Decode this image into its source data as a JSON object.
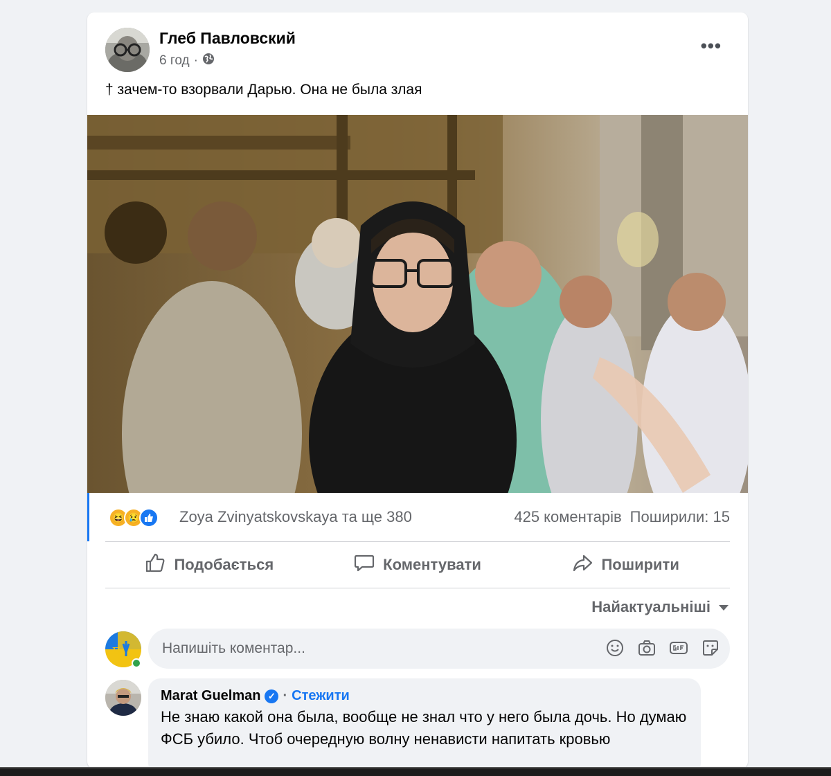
{
  "post": {
    "author": "Глеб Павловский",
    "time": "6 год",
    "separator": "·",
    "text": "† зачем-то взорвали Дарью. Она не была злая",
    "more": "•••"
  },
  "stats": {
    "reactors": "Zoya Zvinyatskovskaya та ще 380",
    "comments": "425 коментарів",
    "shares": "Поширили: 15"
  },
  "actions": {
    "like": "Подобається",
    "comment": "Коментувати",
    "share": "Поширити"
  },
  "sort": {
    "label": "Найактуальніші"
  },
  "composer": {
    "placeholder": "Напишіть коментар..."
  },
  "comment": {
    "author": "Marat Guelman",
    "follow": "Стежити",
    "text": "Не знаю какой она была, вообще не знал что у него была дочь. Но думаю ФСБ убило. Чтоб очередную волну ненависти напитать кровью"
  },
  "colors": {
    "accent": "#1877f2",
    "secondary_text": "#65676b",
    "background": "#f0f2f5"
  }
}
